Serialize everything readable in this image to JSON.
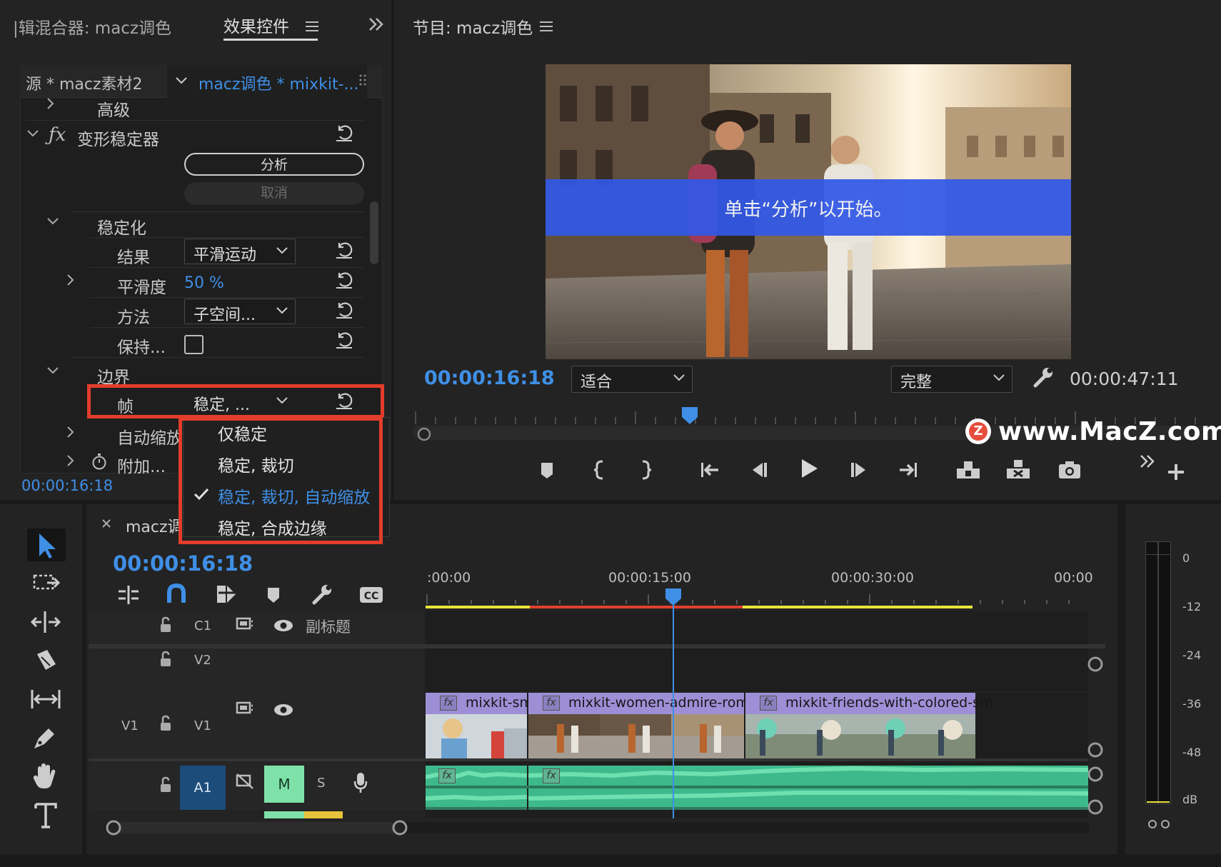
{
  "effect_controls": {
    "tab_audio_mixer": "|辑混合器: macz调色",
    "tab_effect_controls": "效果控件",
    "source_label": "源 * macz素材2",
    "sequence_clip_label": "macz调色 * mixkit-...",
    "rows": {
      "advanced": "高级",
      "effect_name": "变形稳定器",
      "analyze_button": "分析",
      "cancel_button": "取消",
      "stabilization": "稳定化",
      "result_label": "结果",
      "result_value": "平滑运动",
      "smoothness_label": "平滑度",
      "smoothness_value": "50 %",
      "method_label": "方法",
      "method_value": "子空间...",
      "preserve_label": "保持...",
      "borders": "边界",
      "framing_label": "帧",
      "framing_value": "稳定, ...",
      "auto_scale_label": "自动缩放",
      "additional_label": "附加..."
    },
    "timecode": "00:00:16:18"
  },
  "framing_menu": {
    "items": [
      "仅稳定",
      "稳定, 裁切",
      "稳定, 裁切, 自动缩放",
      "稳定, 合成边缘"
    ],
    "selected_index": 2
  },
  "program_monitor": {
    "title": "节目: macz调色",
    "overlay_text": "单击“分析”以开始。",
    "current_timecode": "00:00:16:18",
    "zoom_value": "适合",
    "quality_value": "完整",
    "duration_timecode": "00:00:47:11",
    "watermark": "www.MacZ.com"
  },
  "timeline": {
    "sequence_tab": "macz调",
    "timecode": "00:00:16:18",
    "ruler_labels": [
      ":00:00",
      "00:00:15:00",
      "00:00:30:00",
      "00:00"
    ],
    "tracks": {
      "c1": "C1",
      "c1_name": "副标题",
      "v2": "V2",
      "v1_src": "V1",
      "v1": "V1",
      "a1": "A1",
      "mute": "M",
      "solo": "S"
    },
    "clips": [
      "mixkit-sm",
      "mixkit-women-admire-roma",
      "mixkit-friends-with-colored-sm"
    ],
    "fx_badge": "fx"
  },
  "audio_meter": {
    "labels": [
      "0",
      "-12",
      "-24",
      "-36",
      "-48",
      "dB"
    ]
  },
  "colors": {
    "accent_blue": "#3f8fe6",
    "highlight_red": "#e43d2b",
    "clip_purple": "#9d8fd6",
    "audio_green": "#3eb98b",
    "mute_green": "#7ee2a8",
    "a1_blue": "#1c4c7a"
  }
}
